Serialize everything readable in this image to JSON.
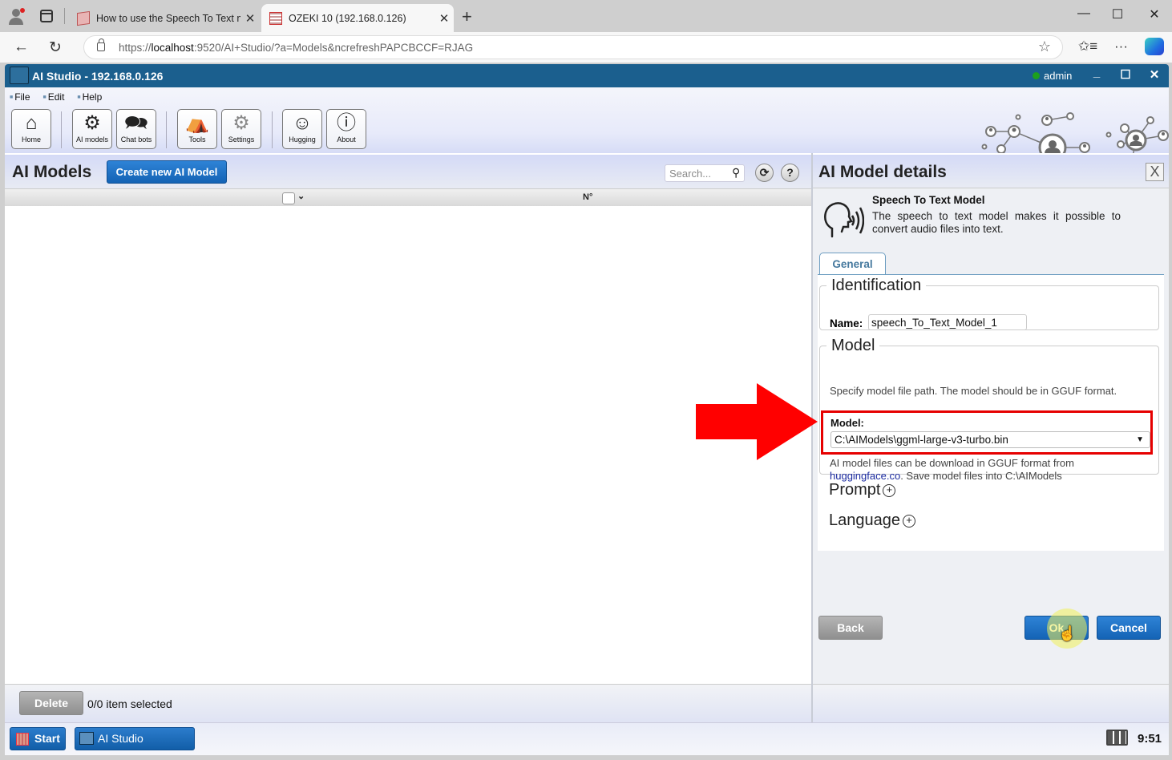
{
  "browser": {
    "tabs": [
      {
        "title": "How to use the Speech To Text m",
        "active": false
      },
      {
        "title": "OZEKI 10 (192.168.0.126)",
        "active": true
      }
    ],
    "url_prefix": "https://",
    "url_host": "localhost",
    "url_rest": ":9520/AI+Studio/?a=Models&ncrefreshPAPCBCCF=RJAG",
    "new_tab_glyph": "+",
    "close_glyph": "✕",
    "back_glyph": "←",
    "reload_glyph": "↻",
    "star_glyph": "☆",
    "favorites_glyph": "✩≡",
    "more_glyph": "···",
    "win_min": "—",
    "win_max": "☐",
    "win_close": "✕"
  },
  "app": {
    "title": "AI Studio - 192.168.0.126",
    "user": "admin",
    "status_color": "#1da01d",
    "min_glyph": "_",
    "max_glyph": "☐",
    "close_glyph": "✕",
    "menu": [
      "File",
      "Edit",
      "Help"
    ],
    "toolbar": [
      {
        "label": "Home",
        "icon": "home-icon",
        "glyph": "⌂"
      },
      {
        "label": "AI models",
        "icon": "ai-models-gear-icon",
        "glyph": "⚙"
      },
      {
        "label": "Chat bots",
        "icon": "chat-bots-icon",
        "glyph": "🗪"
      },
      {
        "label": "Tools",
        "icon": "tools-icon",
        "glyph": "⛺"
      },
      {
        "label": "Settings",
        "icon": "settings-icon",
        "glyph": "⚙"
      },
      {
        "label": "Hugging",
        "icon": "hugging-face-icon",
        "glyph": "☺"
      },
      {
        "label": "About",
        "icon": "info-icon",
        "glyph": "ⓘ"
      }
    ]
  },
  "left_panel": {
    "title": "AI Models",
    "create_button": "Create new AI Model",
    "search_placeholder": "Search...",
    "search_glyph": "⚲",
    "refresh_glyph": "⟳",
    "help_glyph": "?",
    "columns": {
      "select_chevron": "⌄",
      "number": "N°"
    },
    "rows": [],
    "delete_button": "Delete",
    "selection_status": "0/0 item selected"
  },
  "details": {
    "title": "AI Model details",
    "close_glyph": "X",
    "model_type_title": "Speech To Text Model",
    "model_type_desc": "The speech to text model makes it possible to convert audio files into text.",
    "tab": "General",
    "identification": {
      "legend": "Identification",
      "name_label": "Name:",
      "name_value": "speech_To_Text_Model_1"
    },
    "model": {
      "legend": "Model",
      "help": "Specify model file path. The model should be in GGUF format.",
      "label": "Model:",
      "selected": "C:\\AIModels\\ggml-large-v3-turbo.bin",
      "dropdown_glyph": "▼",
      "note_prefix": "AI model files can be download in GGUF format from",
      "note_link": "huggingface.co",
      "note_suffix": ". Save model files into C:\\AIModels"
    },
    "sections": [
      {
        "label": "Prompt",
        "glyph": "+"
      },
      {
        "label": "Language",
        "glyph": "+"
      }
    ],
    "back_button": "Back",
    "ok_button": "Ok",
    "cancel_button": "Cancel"
  },
  "annotation": {
    "arrow_color": "#ff0000",
    "highlight_color": "#e60000"
  },
  "taskbar": {
    "start": "Start",
    "app_item": "AI Studio",
    "clock": "9:51"
  }
}
